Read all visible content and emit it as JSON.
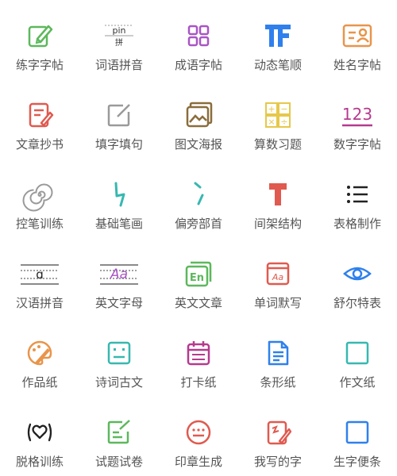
{
  "colors": {
    "label": "#555555",
    "green": "#5cb85c",
    "purple": "#a855c5",
    "blue": "#2f80ed",
    "orange": "#e8954a",
    "red": "#e05a4f",
    "gold": "#e6c84a",
    "teal": "#37b8b0",
    "magenta": "#b63a8f",
    "gray": "#9a9a9a",
    "brown": "#8a6d3b"
  },
  "tools": [
    {
      "label": "练字字帖",
      "icon": "pen-square-icon"
    },
    {
      "label": "词语拼音",
      "icon": "pinyin-card-icon",
      "glyph_top": "pin",
      "glyph_bottom": "拼"
    },
    {
      "label": "成语字帖",
      "icon": "four-squares-icon"
    },
    {
      "label": "动态笔顺",
      "icon": "tf-logo-icon"
    },
    {
      "label": "姓名字帖",
      "icon": "name-card-icon"
    },
    {
      "label": "文章抄书",
      "icon": "document-pencil-icon"
    },
    {
      "label": "填字填句",
      "icon": "edit-square-icon"
    },
    {
      "label": "图文海报",
      "icon": "image-poster-icon"
    },
    {
      "label": "算数习题",
      "icon": "calculator-icon",
      "glyphs": [
        "+",
        "−",
        "×",
        "÷"
      ]
    },
    {
      "label": "数字字帖",
      "icon": "number-icon",
      "glyph": "123"
    },
    {
      "label": "控笔训练",
      "icon": "spiral-icon"
    },
    {
      "label": "基础笔画",
      "icon": "stroke-zigzag-icon"
    },
    {
      "label": "偏旁部首",
      "icon": "radical-stroke-icon"
    },
    {
      "label": "间架结构",
      "icon": "structure-icon"
    },
    {
      "label": "表格制作",
      "icon": "list-icon"
    },
    {
      "label": "汉语拼音",
      "icon": "pinyin-lines-icon",
      "glyph": "ɑ"
    },
    {
      "label": "英文字母",
      "icon": "letter-lines-icon",
      "glyph": "Aa"
    },
    {
      "label": "英文文章",
      "icon": "english-doc-icon",
      "glyph": "En"
    },
    {
      "label": "单词默写",
      "icon": "word-window-icon",
      "glyph": "Aa"
    },
    {
      "label": "舒尔特表",
      "icon": "eye-icon"
    },
    {
      "label": "作品纸",
      "icon": "palette-brush-icon"
    },
    {
      "label": "诗词古文",
      "icon": "poem-card-icon"
    },
    {
      "label": "打卡纸",
      "icon": "calendar-icon"
    },
    {
      "label": "条形纸",
      "icon": "striped-doc-icon"
    },
    {
      "label": "作文纸",
      "icon": "blank-square-icon"
    },
    {
      "label": "脱格训练",
      "icon": "heart-wave-icon"
    },
    {
      "label": "试题试卷",
      "icon": "exam-edit-icon"
    },
    {
      "label": "印章生成",
      "icon": "stamp-icon"
    },
    {
      "label": "我写的字",
      "icon": "my-writing-icon"
    },
    {
      "label": "生字便条",
      "icon": "note-square-icon"
    }
  ]
}
